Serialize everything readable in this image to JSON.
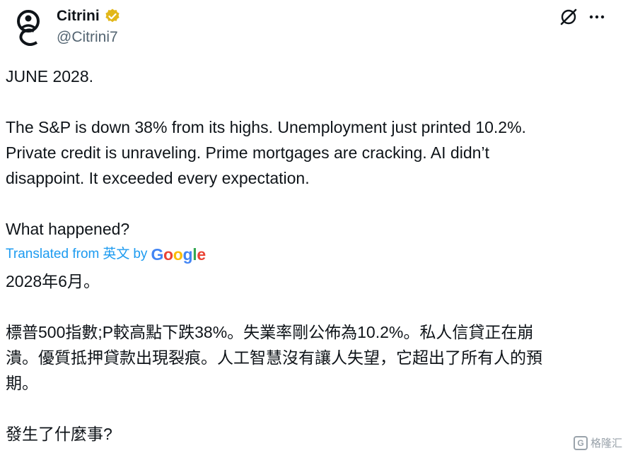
{
  "author": {
    "display_name": "Citrini",
    "handle": "@Citrini7",
    "verified_color": "#e2b719"
  },
  "tweet": {
    "paragraphs": [
      "JUNE 2028.",
      "The S&P is down 38% from its highs. Unemployment just printed 10.2%.\nPrivate credit is unraveling. Prime mortgages are cracking. AI didn’t\ndisappoint. It exceeded every expectation.",
      "What happened?"
    ]
  },
  "translation": {
    "prefix": "Translated from",
    "source_language": "英文",
    "by": "by",
    "provider_letters": [
      "G",
      "o",
      "o",
      "g",
      "l",
      "e"
    ],
    "paragraphs": [
      "2028年6月。",
      "標普500指數;P較高點下跌38%。失業率剛公佈為10.2%。私人信貸正在崩\n潰。優質抵押貸款出現裂痕。人工智慧沒有讓人失望，它超出了所有人的預\n期。",
      "發生了什麼事?"
    ]
  },
  "watermark": {
    "text": "格隆汇",
    "box_glyph": "G"
  },
  "icons": {
    "grok": "grok-icon",
    "more": "more-icon",
    "verified": "verified-badge-icon"
  },
  "colors": {
    "link": "#1d9bf0",
    "secondary_text": "#536471",
    "primary_text": "#0f1419"
  }
}
